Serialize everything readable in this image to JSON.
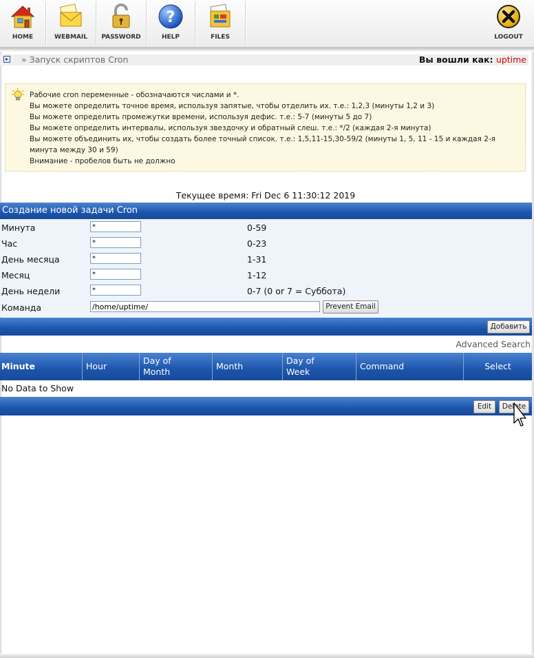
{
  "toolbar": {
    "home": "HOME",
    "webmail": "WEBMAIL",
    "password": "PASSWORD",
    "help": "HELP",
    "files": "FILES",
    "logout": "LOGOUT"
  },
  "breadcrumb": {
    "text": "» Запуск скриптов Cron"
  },
  "login": {
    "label": "Вы вошли как:",
    "user": "uptime"
  },
  "info": {
    "lines": [
      "Рабочие cron переменные - обозначаются числами и *.",
      "Вы можете определить точное время, используя запятые, чтобы отделить их. т.е.: 1,2,3 (минуты 1,2 и 3)",
      "Вы можете определить промежутки времени, используя дефис. т.е.: 5-7 (минуты 5 до 7)",
      "Вы можете определить интервалы, используя звездочку и обратный слеш. т.е.: */2 (каждая 2-я минута)",
      "Вы можете объединить их, чтобы создать более точный список. т.е.: 1,5,11-15,30-59/2 (минуты 1, 5, 11 - 15 и каждая 2-я минута между 30 и 59)",
      "Внимание - пробелов быть не должно"
    ]
  },
  "current_time": "Текущее время: Fri Dec 6 11:30:12 2019",
  "create": {
    "title": "Создание новой задачи Cron",
    "rows": [
      {
        "label": "Минута",
        "value": "*",
        "range": "0-59"
      },
      {
        "label": "Час",
        "value": "*",
        "range": "0-23"
      },
      {
        "label": "День месяца",
        "value": "*",
        "range": "1-31"
      },
      {
        "label": "Месяц",
        "value": "*",
        "range": "1-12"
      },
      {
        "label": "День недели",
        "value": "*",
        "range": "0-7 (0 or 7 = Суббота)"
      }
    ],
    "command_label": "Команда",
    "command_value": "/home/uptime/",
    "prevent_email": "Prevent Email",
    "add_button": "Добавить"
  },
  "advanced_search": "Advanced Search",
  "table": {
    "columns": [
      "Minute",
      "Hour",
      "Day of Month",
      "Month",
      "Day of Week",
      "Command",
      "Select"
    ],
    "empty": "No Data to Show",
    "edit_button": "Edit",
    "delete_button": "Delete"
  },
  "colors": {
    "header_blue": "#1c55ac",
    "form_bg": "#eef4fa",
    "info_bg": "#fdf8e2",
    "user_red": "#d90000"
  }
}
